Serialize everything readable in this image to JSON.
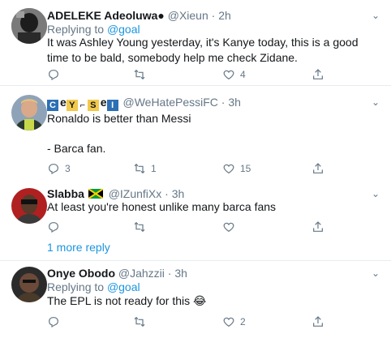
{
  "tweets": [
    {
      "name": "ADELEKE Adeoluwa●",
      "handle": "@Xieun · 2h",
      "replying_prefix": "Replying to",
      "replying_to": "@goal",
      "text": "It was Ashley Young yesterday, it's Kanye today, this is a good time to be bald, somebody help me check Zidane.",
      "replies": "",
      "retweets": "",
      "likes": "4"
    },
    {
      "name_badges": [
        "C",
        "Y",
        "S",
        "I"
      ],
      "name_sep": "e",
      "handle": "@WeHatePessiFC · 3h",
      "text_line1": "Ronaldo is better than Messi",
      "text_line2": "- Barca fan.",
      "replies": "3",
      "retweets": "1",
      "likes": "15"
    },
    {
      "name": "Slabba",
      "handle": "@IZunfiXx · 3h",
      "text": "At least you're honest unlike many barca fans",
      "replies": "",
      "retweets": "",
      "likes": ""
    },
    {
      "name": "Onye Obodo",
      "handle": "@Jahzzii · 3h",
      "replying_prefix": "Replying to",
      "replying_to": "@goal",
      "text": "The EPL is not ready for this 😂",
      "replies": "",
      "retweets": "",
      "likes": "2"
    }
  ],
  "thread": {
    "more_replies_label": "1 more reply"
  },
  "colors": {
    "accent": "#1b95e0",
    "secondary_text": "#657786",
    "divider": "#e6ecf0"
  }
}
